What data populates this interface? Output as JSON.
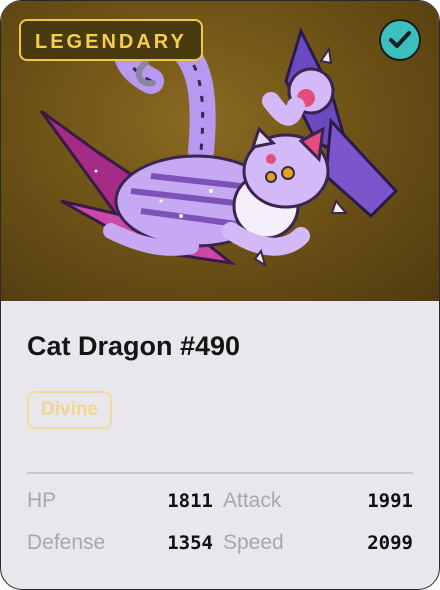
{
  "card": {
    "rarity": "LEGENDARY",
    "verified_icon": "checkmark-icon",
    "name": "Cat Dragon #490",
    "type_badge": "Divine",
    "stats": [
      {
        "label": "HP",
        "value": "1811"
      },
      {
        "label": "Attack",
        "value": "1991"
      },
      {
        "label": "Defense",
        "value": "1354"
      },
      {
        "label": "Speed",
        "value": "2099"
      }
    ]
  },
  "colors": {
    "art_background": "#6f5417",
    "rarity_gold": "#f2c744",
    "verified_teal": "#3bbfbe",
    "badge_gold": "#efd78f",
    "card_background": "#e9e7ec"
  }
}
